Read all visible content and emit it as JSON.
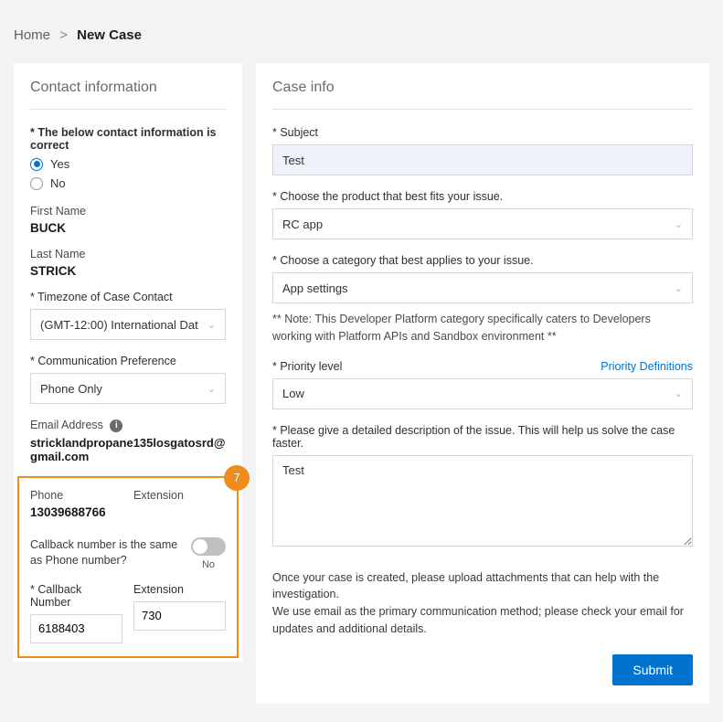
{
  "breadcrumb": {
    "home": "Home",
    "current": "New Case"
  },
  "left": {
    "title": "Contact information",
    "confirm_label": "* The below contact information is correct",
    "yes": "Yes",
    "no": "No",
    "first_name_label": "First Name",
    "first_name": "BUCK",
    "last_name_label": "Last Name",
    "last_name": "STRICK",
    "timezone_label": "* Timezone of Case Contact",
    "timezone_value": "(GMT-12:00) International Dat",
    "comm_pref_label": "* Communication Preference",
    "comm_pref_value": "Phone Only",
    "email_label": "Email Address",
    "email_value": "stricklandpropane135losgatosrd@gmail.com",
    "phone_label": "Phone",
    "phone_value": "13039688766",
    "extension_label": "Extension",
    "callback_same_label": "Callback number is the same as Phone number?",
    "toggle_state": "No",
    "callback_number_label": "* Callback Number",
    "callback_number_value": "6188403",
    "callback_ext_label": "Extension",
    "callback_ext_value": "730",
    "step_badge": "7"
  },
  "right": {
    "title": "Case info",
    "subject_label": "* Subject",
    "subject_value": "Test",
    "product_label": "* Choose the product that best fits your issue.",
    "product_value": "RC app",
    "category_label": "* Choose a category that best applies to your issue.",
    "category_value": "App settings",
    "category_note": "** Note: This Developer Platform category specifically caters to Developers working with Platform APIs and Sandbox environment **",
    "priority_label": "* Priority level",
    "priority_link": "Priority Definitions",
    "priority_value": "Low",
    "description_label": "* Please give a detailed description of the issue. This will help us solve the case faster.",
    "description_value": "Test",
    "help_line1": "Once your case is created, please upload attachments that can help with the investigation.",
    "help_line2": "We use email as the primary communication method; please check your email for updates and additional details.",
    "submit": "Submit"
  }
}
